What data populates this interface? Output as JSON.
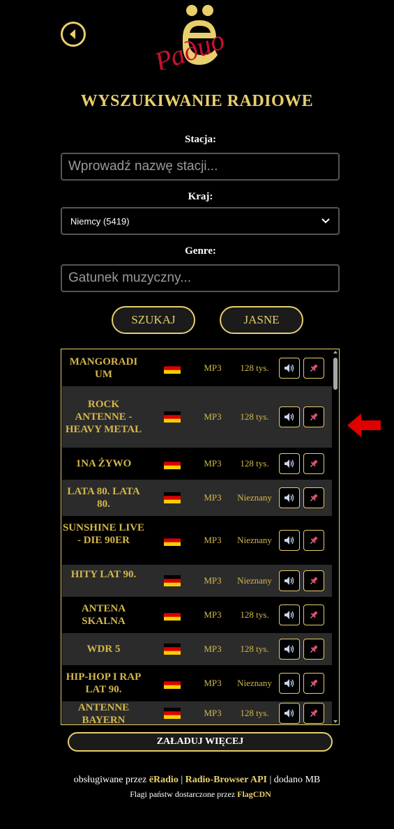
{
  "header": {
    "logo_text": "Радио"
  },
  "title": "WYSZUKIWANIE RADIOWE",
  "form": {
    "station_label": "Stacja:",
    "station_placeholder": "Wprowadź nazwę stacji...",
    "country_label": "Kraj:",
    "country_value": "Niemcy (5419)",
    "genre_label": "Genre:",
    "genre_placeholder": "Gatunek muzyczny...",
    "search_button": "SZUKAJ",
    "clear_button": "JASNE"
  },
  "results": [
    {
      "name": "MANGORADI UM",
      "codec": "MP3",
      "bitrate": "128 tys."
    },
    {
      "name": "ROCK ANTENNE - HEAVY METAL",
      "codec": "MP3",
      "bitrate": "128 tys."
    },
    {
      "name": "1NA ŻYWO",
      "codec": "MP3",
      "bitrate": "128 tys."
    },
    {
      "name": "LATA 80. LATA 80.",
      "codec": "MP3",
      "bitrate": "Nieznany"
    },
    {
      "name": "SUNSHINE LIVE - DIE 90ER",
      "codec": "MP3",
      "bitrate": "Nieznany"
    },
    {
      "name": "HITY LAT 90.",
      "codec": "MP3",
      "bitrate": "Nieznany"
    },
    {
      "name": "ANTENA SKALNA",
      "codec": "MP3",
      "bitrate": "128 tys."
    },
    {
      "name": "WDR 5",
      "codec": "MP3",
      "bitrate": "128 tys."
    },
    {
      "name": "HIP-HOP I RAP LAT 90.",
      "codec": "MP3",
      "bitrate": "Nieznany"
    },
    {
      "name": "ANTENNE BAYERN",
      "codec": "MP3",
      "bitrate": "128 tys."
    }
  ],
  "load_more": "ZAŁADUJ WIĘCEJ",
  "footer": {
    "line1_prefix": "obsługiwane przez",
    "line1_brand": "ëRadio",
    "line1_sep1": "|",
    "line1_api": "Radio-Browser API",
    "line1_sep2": "|",
    "line1_suffix": "dodano MB",
    "line2_prefix": "Flagi państw dostarczone przez",
    "line2_link": "FlagCDN"
  },
  "colors": {
    "accent": "#e8cf6c",
    "row_text": "#d4b84a",
    "pin": "#e0506e",
    "logo_red": "#c8102e"
  }
}
